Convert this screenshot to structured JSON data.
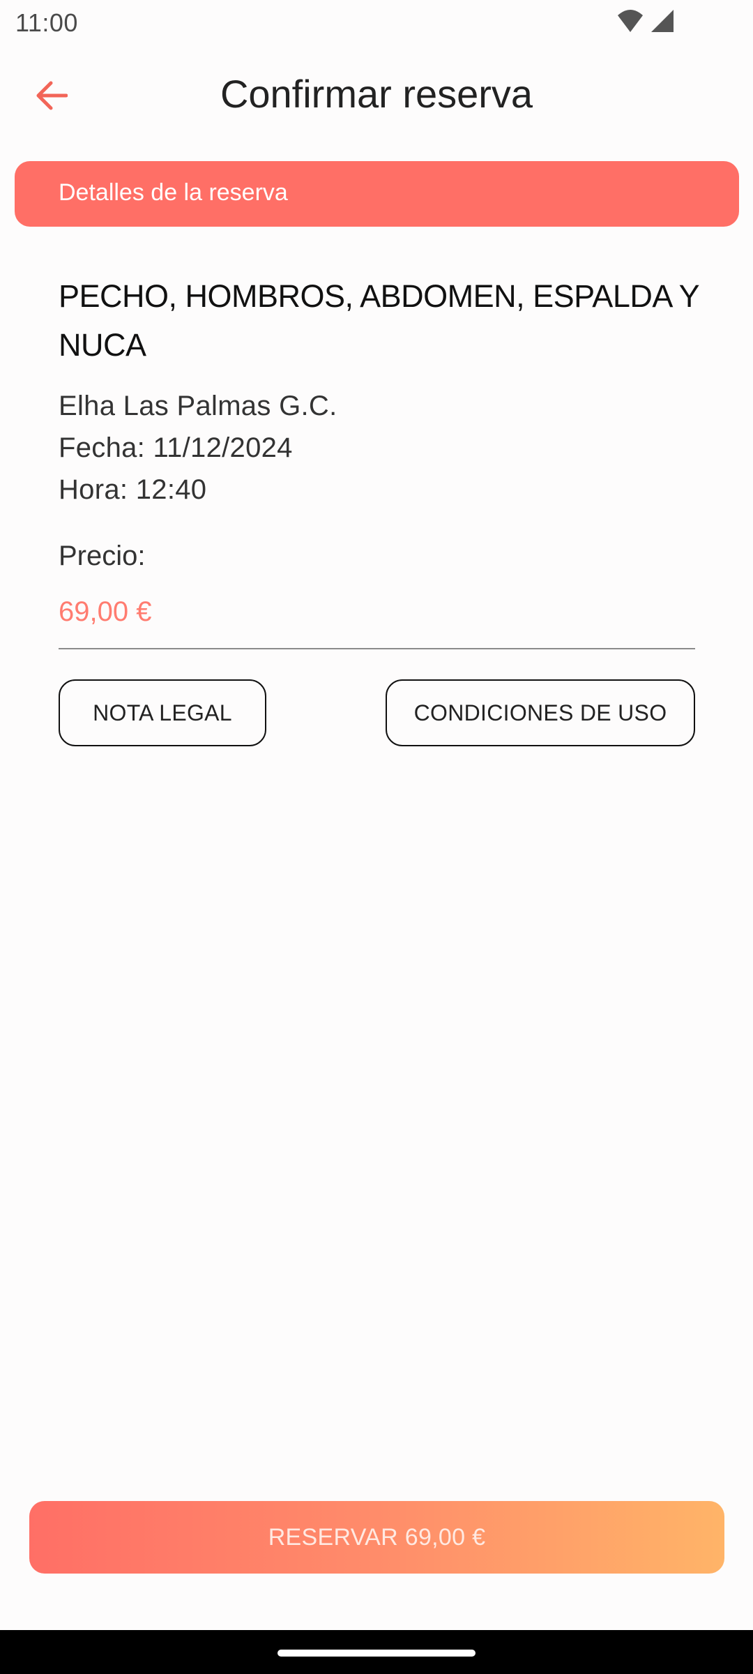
{
  "status_bar": {
    "time": "11:00",
    "icons": [
      "wifi-icon",
      "cellular-signal-icon"
    ]
  },
  "app_bar": {
    "title": "Confirmar reserva",
    "back_icon": "arrow-left-icon"
  },
  "banner": {
    "label": "Detalles de la reserva"
  },
  "details": {
    "treatment": "PECHO, HOMBROS, ABDOMEN, ESPALDA Y NUCA",
    "location": "Elha Las Palmas G.C.",
    "date": "Fecha: 11/12/2024",
    "time": "Hora: 12:40",
    "price_label": "Precio:",
    "price_value": "69,00 €"
  },
  "buttons": {
    "legal": "NOTA LEGAL",
    "conditions": "CONDICIONES DE USO",
    "reserve": "RESERVAR 69,00 €"
  },
  "colors": {
    "accent": "#ff6f66",
    "price": "#ff7c70",
    "cta_gradient_start": "#ff6f66",
    "cta_gradient_end": "#ffb468"
  }
}
